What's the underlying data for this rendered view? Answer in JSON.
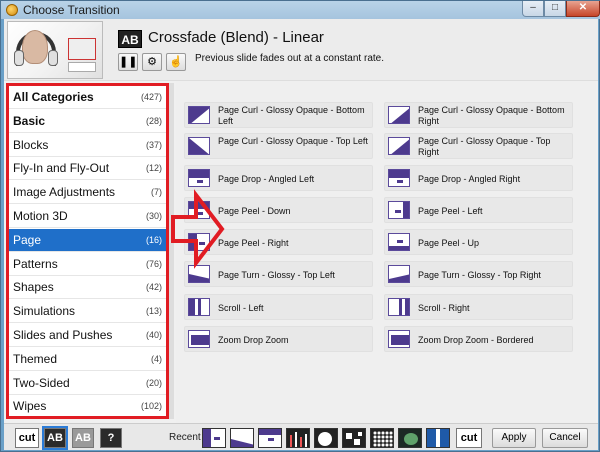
{
  "window": {
    "title": "Choose Transition"
  },
  "current": {
    "icon_label": "AB",
    "name": "Crossfade (Blend) - Linear",
    "description": "Previous slide fades out at a constant rate."
  },
  "categories": [
    {
      "label": "All Categories",
      "count": "(427)"
    },
    {
      "label": "Basic",
      "count": "(28)"
    },
    {
      "label": "Blocks",
      "count": "(37)"
    },
    {
      "label": "Fly-In and Fly-Out",
      "count": "(12)"
    },
    {
      "label": "Image Adjustments",
      "count": "(7)"
    },
    {
      "label": "Motion 3D",
      "count": "(30)"
    },
    {
      "label": "Page",
      "count": "(16)"
    },
    {
      "label": "Patterns",
      "count": "(76)"
    },
    {
      "label": "Shapes",
      "count": "(42)"
    },
    {
      "label": "Simulations",
      "count": "(13)"
    },
    {
      "label": "Slides and Pushes",
      "count": "(40)"
    },
    {
      "label": "Themed",
      "count": "(4)"
    },
    {
      "label": "Two-Sided",
      "count": "(20)"
    },
    {
      "label": "Wipes",
      "count": "(102)"
    }
  ],
  "transitions": [
    "Page Curl - Glossy Opaque - Bottom Left",
    "Page Curl - Glossy Opaque - Bottom Right",
    "Page Curl - Glossy Opaque - Top Left",
    "Page Curl - Glossy Opaque - Top Right",
    "Page Drop - Angled Left",
    "Page Drop - Angled Right",
    "Page Peel - Down",
    "Page Peel - Left",
    "Page Peel - Right",
    "Page Peel - Up",
    "Page Turn - Glossy - Top Left",
    "Page Turn - Glossy - Top Right",
    "Scroll - Left",
    "Scroll - Right",
    "Zoom Drop Zoom",
    "Zoom Drop Zoom - Bordered"
  ],
  "bottom": {
    "cut_label": "cut",
    "ab_label": "AB",
    "ab2_label": "AB",
    "help_label": "?",
    "recent_label": "Recent",
    "recent_cut_label": "cut",
    "apply_label": "Apply",
    "cancel_label": "Cancel"
  },
  "colors": {
    "selection": "#1f6fc9",
    "highlight": "#e11c23",
    "icon": "#4d3a8e"
  }
}
